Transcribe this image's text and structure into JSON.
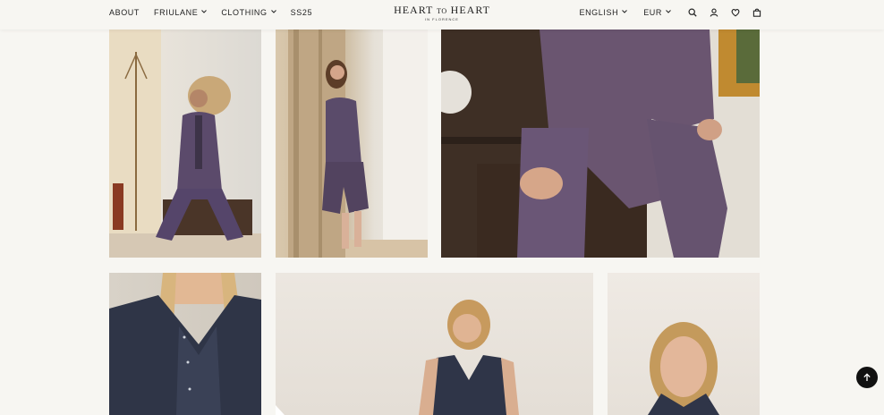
{
  "nav": {
    "left": [
      {
        "label": "ABOUT",
        "has_dropdown": false
      },
      {
        "label": "FRIULANE",
        "has_dropdown": true
      },
      {
        "label": "CLOTHING",
        "has_dropdown": true
      },
      {
        "label": "SS25",
        "has_dropdown": false
      }
    ],
    "language": "ENGLISH",
    "currency": "EUR",
    "icons": [
      "search-icon",
      "account-icon",
      "wishlist-heart-icon",
      "cart-bag-icon"
    ]
  },
  "logo": {
    "part1": "HEART",
    "part2": "TO",
    "part3": "HEART",
    "subtitle": "IN FLORENCE"
  },
  "colors": {
    "background": "#f7f6f2",
    "text": "#222222",
    "back_to_top_bg": "#111111",
    "garment_purple": "#5b4a6b",
    "garment_navy": "#2f3547"
  },
  "chevron": "⌄",
  "back_to_top_icon": "arrow-up-icon"
}
